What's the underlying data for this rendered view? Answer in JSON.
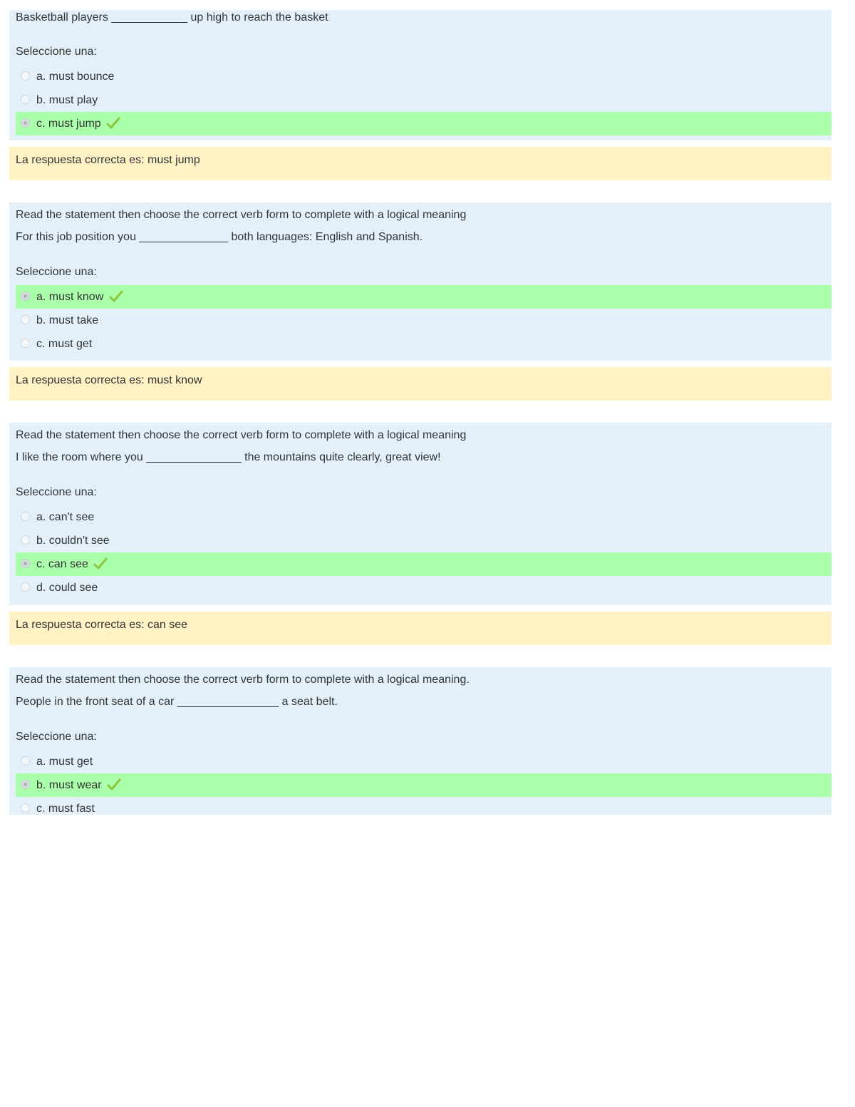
{
  "selection_prompt": "Seleccione una:",
  "colors": {
    "question_bg": "#e3f0f9",
    "correct_bg": "#aaffaa",
    "feedback_bg": "#fff3c6",
    "check_color": "#8cc63f"
  },
  "questions": [
    {
      "lines": [
        "Basketball players ____________ up high to reach the basket"
      ],
      "prompt": "Seleccione una:",
      "answers": [
        {
          "label": "a. must bounce",
          "selected": false,
          "correct": false
        },
        {
          "label": "b. must play",
          "selected": false,
          "correct": false
        },
        {
          "label": "c. must jump",
          "selected": true,
          "correct": true
        }
      ],
      "feedback": "La respuesta correcta es: must jump"
    },
    {
      "lines": [
        "Read the statement then choose the correct verb form to complete with a logical meaning",
        "For this job position you ______________ both languages: English and Spanish."
      ],
      "prompt": "Seleccione una:",
      "answers": [
        {
          "label": "a. must know",
          "selected": true,
          "correct": true
        },
        {
          "label": "b. must take",
          "selected": false,
          "correct": false
        },
        {
          "label": "c. must get",
          "selected": false,
          "correct": false
        }
      ],
      "feedback": "La respuesta correcta es: must know"
    },
    {
      "lines": [
        "Read the statement then choose the correct verb form to complete with a logical meaning",
        "I like the room where you _______________ the mountains quite clearly, great view!"
      ],
      "prompt": "Seleccione una:",
      "answers": [
        {
          "label": "a. can't see",
          "selected": false,
          "correct": false
        },
        {
          "label": "b. couldn't see",
          "selected": false,
          "correct": false
        },
        {
          "label": "c. can see",
          "selected": true,
          "correct": true
        },
        {
          "label": "d. could see",
          "selected": false,
          "correct": false
        }
      ],
      "feedback": "La respuesta correcta es: can see"
    },
    {
      "lines": [
        "Read the statement then choose the correct verb form to complete with a logical meaning.",
        "People in the front seat of a car ________________ a seat belt."
      ],
      "prompt": "Seleccione una:",
      "answers": [
        {
          "label": "a. must get",
          "selected": false,
          "correct": false
        },
        {
          "label": "b. must wear",
          "selected": true,
          "correct": true
        },
        {
          "label": "c. must fast",
          "selected": false,
          "correct": false
        }
      ],
      "feedback": null
    }
  ]
}
